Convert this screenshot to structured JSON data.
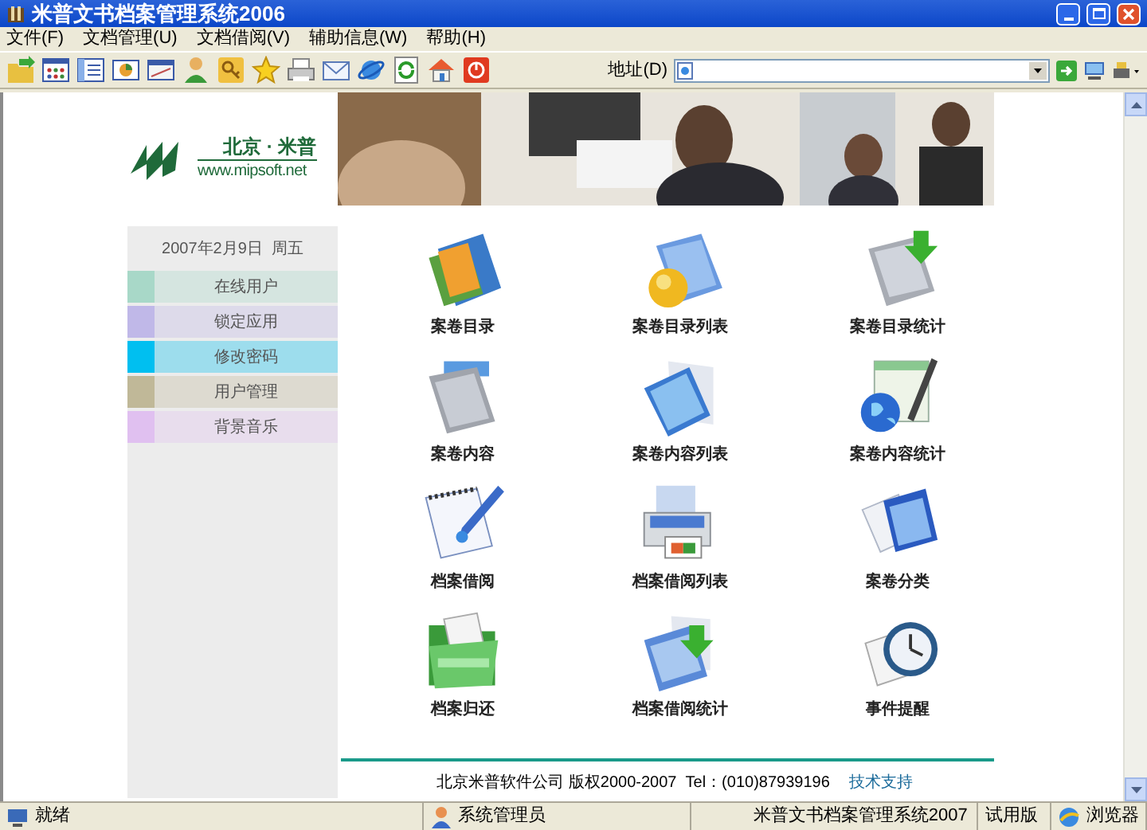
{
  "window": {
    "title": "米普文书档案管理系统2006"
  },
  "menu": [
    "文件(F)",
    "文档管理(U)",
    "文档借阅(V)",
    "辅助信息(W)",
    "帮助(H)"
  ],
  "address": {
    "label": "地址(D)"
  },
  "logo": {
    "name": "北京 · 米普",
    "url": "www.mipsoft.net"
  },
  "sidebar": {
    "date": "2007年2月9日  周五",
    "items": [
      {
        "label": "在线用户",
        "color": "#a8d8c8"
      },
      {
        "label": "锁定应用",
        "color": "#c0b8e8"
      },
      {
        "label": "修改密码",
        "color": "#00bff0"
      },
      {
        "label": "用户管理",
        "color": "#c0b898"
      },
      {
        "label": "背景音乐",
        "color": "#e0c0f0"
      }
    ]
  },
  "modules": [
    {
      "label": "案卷目录"
    },
    {
      "label": "案卷目录列表"
    },
    {
      "label": "案卷目录统计"
    },
    {
      "label": "案卷内容"
    },
    {
      "label": "案卷内容列表"
    },
    {
      "label": "案卷内容统计"
    },
    {
      "label": "档案借阅"
    },
    {
      "label": "档案借阅列表"
    },
    {
      "label": "案卷分类"
    },
    {
      "label": "档案归还"
    },
    {
      "label": "档案借阅统计"
    },
    {
      "label": "事件提醒"
    }
  ],
  "footer": {
    "text": "北京米普软件公司 版权2000-2007  Tel：(010)87939196",
    "link": "技术支持"
  },
  "status_bar": [
    "就绪",
    "系统管理员",
    "米普文书档案管理系统2007",
    "试用版",
    "浏览器"
  ]
}
